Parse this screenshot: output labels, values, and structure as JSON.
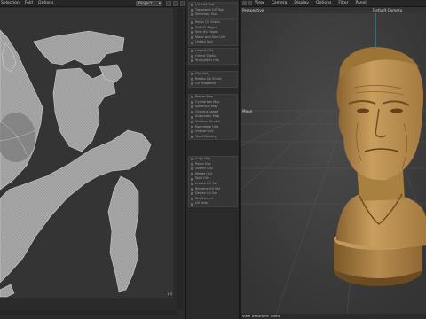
{
  "uv_editor": {
    "menu": [
      "Selection",
      "Fold",
      "Options"
    ],
    "dropdown_value": "Project",
    "corner_label": "1.0"
  },
  "side_panel": {
    "groups": [
      {
        "items": [
          "UV Edit Tool",
          "Transform UV Tool",
          "Selection Tool"
        ]
      },
      {
        "items": [
          "Relax UV Shells",
          "Cut UV Edges",
          "Sew UV Edges",
          "Move and Sew UVs",
          "Unfold UVs"
        ]
      },
      {
        "items": [
          "Layout UVs",
          "Orient Shells",
          "Straighten UVs"
        ]
      },
      {
        "items": [
          "Flip UVs",
          "Rotate UV Shells",
          "UV Snapshot"
        ]
      },
      {
        "items": [
          "Planar Map",
          "Cylindrical Map",
          "Spherical Map",
          "Camera-based",
          "Automatic Map",
          "Contour Stretch",
          "Normalize UVs",
          "Unitize UVs",
          "Texel Density"
        ]
      },
      {
        "items": [
          "Copy UVs",
          "Paste UVs",
          "Delete UVs",
          "Merge UVs",
          "Split UVs",
          "Create UV Set",
          "Rename UV Set",
          "Delete UV Set",
          "Set Current",
          "UV Sets"
        ]
      }
    ]
  },
  "viewport": {
    "menu": [
      "View",
      "Camera",
      "Display",
      "Options",
      "Filter",
      "Panel"
    ],
    "perspective_label": "Perspective",
    "camera_label": "Default Camera",
    "axis_label": "Move",
    "status": "View Transform: Scene"
  },
  "colors": {
    "uv_shell": "#a9a9a9",
    "uv_edge": "#d0d0d0",
    "bust_base": "#c59a5c",
    "bust_shadow": "#7e5b2d",
    "accent_cyan": "#2fb8b8"
  }
}
